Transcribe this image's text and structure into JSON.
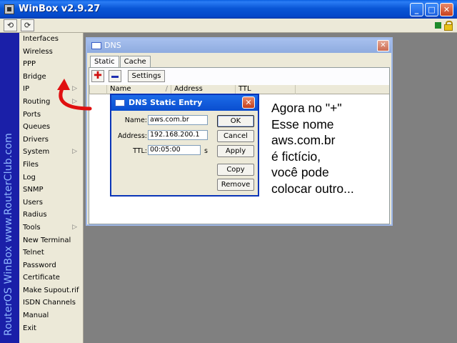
{
  "window": {
    "title": "WinBox v2.9.27",
    "controls": {
      "minimize": "_",
      "maximize": "□",
      "close": "✕"
    }
  },
  "toolbar": {
    "undo_icon": "undo-icon",
    "redo_icon": "redo-icon",
    "undo_glyph": "⟲",
    "redo_glyph": "⟳",
    "status_color": "#1d8a2a"
  },
  "branding": {
    "vertical_text": "RouterOS WinBox   www.RouterClub.com"
  },
  "sidebar": {
    "items": [
      {
        "label": "Interfaces",
        "submenu": false
      },
      {
        "label": "Wireless",
        "submenu": false
      },
      {
        "label": "PPP",
        "submenu": false
      },
      {
        "label": "Bridge",
        "submenu": false
      },
      {
        "label": "IP",
        "submenu": true
      },
      {
        "label": "Routing",
        "submenu": true
      },
      {
        "label": "Ports",
        "submenu": false
      },
      {
        "label": "Queues",
        "submenu": false
      },
      {
        "label": "Drivers",
        "submenu": false
      },
      {
        "label": "System",
        "submenu": true
      },
      {
        "label": "Files",
        "submenu": false
      },
      {
        "label": "Log",
        "submenu": false
      },
      {
        "label": "SNMP",
        "submenu": false
      },
      {
        "label": "Users",
        "submenu": false
      },
      {
        "label": "Radius",
        "submenu": false
      },
      {
        "label": "Tools",
        "submenu": true
      },
      {
        "label": "New Terminal",
        "submenu": false
      },
      {
        "label": "Telnet",
        "submenu": false
      },
      {
        "label": "Password",
        "submenu": false
      },
      {
        "label": "Certificate",
        "submenu": false
      },
      {
        "label": "Make Supout.rif",
        "submenu": false
      },
      {
        "label": "ISDN Channels",
        "submenu": false
      },
      {
        "label": "Manual",
        "submenu": false
      },
      {
        "label": "Exit",
        "submenu": false
      }
    ]
  },
  "dns_window": {
    "title": "DNS",
    "close": "✕",
    "tabs": [
      {
        "label": "Static",
        "active": true
      },
      {
        "label": "Cache",
        "active": false
      }
    ],
    "add_glyph": "✚",
    "settings_label": "Settings",
    "columns": [
      {
        "label": "Name",
        "sort": "/"
      },
      {
        "label": "Address"
      },
      {
        "label": "TTL"
      }
    ]
  },
  "dialog": {
    "title": "DNS Static Entry",
    "close": "✕",
    "fields": {
      "name": {
        "label": "Name:",
        "value": "aws.com.br"
      },
      "address": {
        "label": "Address:",
        "value": "192.168.200.1"
      },
      "ttl": {
        "label": "TTL:",
        "value": "00:05:00",
        "unit": "s"
      }
    },
    "buttons": {
      "ok": "OK",
      "cancel": "Cancel",
      "apply": "Apply",
      "copy": "Copy",
      "remove": "Remove"
    }
  },
  "annotation": {
    "lines": [
      "Agora no  \"+\"",
      "Esse nome",
      "aws.com.br",
      "é fictício,",
      "você pode",
      "colocar outro..."
    ],
    "arrow_color": "#e01010"
  }
}
